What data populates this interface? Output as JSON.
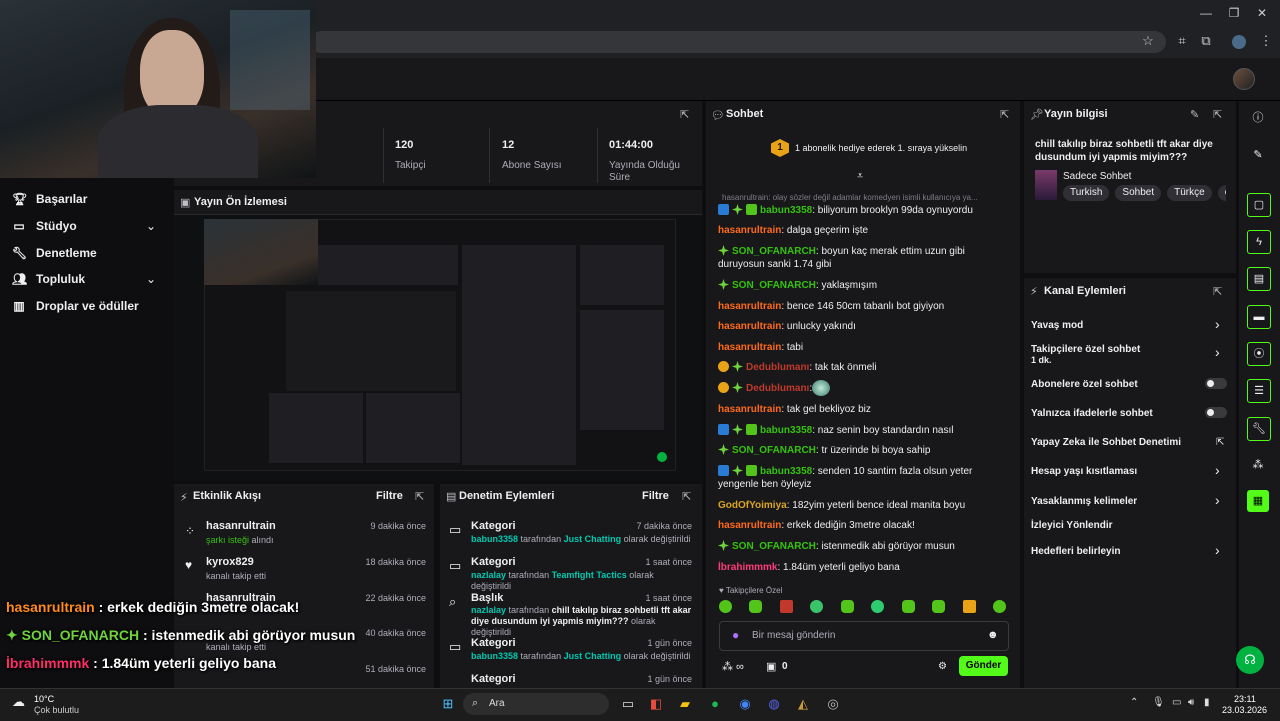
{
  "header": {
    "stats": [
      {
        "value": "120",
        "label": "Takipçi"
      },
      {
        "value": "12",
        "label": "Abone Sayısı"
      },
      {
        "value": "01:44:00",
        "label": "Yayında Olduğu Süre"
      }
    ]
  },
  "nav": {
    "items": [
      {
        "label": "Başarılar"
      },
      {
        "label": "Stüdyo"
      },
      {
        "label": "Denetleme"
      },
      {
        "label": "Topluluk"
      },
      {
        "label": "Droplar ve ödüller"
      }
    ]
  },
  "preview": {
    "title": "Yayın Ön İzlemesi"
  },
  "activity": {
    "title": "Etkinlik Akışı",
    "filter": "Filtre",
    "items": [
      {
        "name": "hasanrultrain",
        "sub_a": "şarkı isteği",
        "sub_b": " alındı",
        "time": "9 dakika önce"
      },
      {
        "name": "kyrox829",
        "sub": "kanalı takip etti",
        "time": "18 dakika önce"
      },
      {
        "name": "hasanrultrain",
        "sub": "",
        "time": "22 dakika önce"
      },
      {
        "name": "",
        "sub": "kanalı takip etti",
        "time": "40 dakika önce"
      },
      {
        "name": "",
        "sub": "",
        "time": "51 dakika önce"
      }
    ]
  },
  "modlog": {
    "title": "Denetim Eylemleri",
    "filter": "Filtre",
    "by": "tarafından",
    "changed": "olarak değiştirildi",
    "items": [
      {
        "type": "Kategori",
        "user": "babun3358",
        "value": "Just Chatting",
        "time": "7 dakika önce"
      },
      {
        "type": "Kategori",
        "user": "nazlalay",
        "value": "Teamfight Tactics",
        "time": "1 saat önce"
      },
      {
        "type": "Başlık",
        "user": "nazlalay",
        "value": "chill takılıp biraz sohbetli tft akar diye dusundum iyi yapmis miyim???",
        "time": "1 saat önce"
      },
      {
        "type": "Kategori",
        "user": "babun3358",
        "value": "Just Chatting",
        "time": "1 gün önce"
      },
      {
        "type": "Kategori",
        "user": "",
        "value": "",
        "time": "1 gün önce"
      }
    ]
  },
  "overlay": {
    "lines": [
      {
        "user": "hasanrultrain",
        "msg": " : erkek dediğin 3metre olacak!"
      },
      {
        "user": "SON_OFANARCH",
        "msg": " : istenmedik abi görüyor musun"
      },
      {
        "user": "İbrahimmmk",
        "msg": " : 1.84üm yeterli geliyo bana"
      }
    ]
  },
  "chat": {
    "title": "Sohbet",
    "gift_banner": "1 abonelik hediye ederek 1. sıraya yükselin",
    "gift_rank": "1",
    "pinned_preview": "hasanrultrain: olay sözler değil adamlar komedyen isimli kullanıcıya ya...",
    "messages": [
      {
        "user": "babun3358",
        "cls": "u-green",
        "badges": [
          "b-blue",
          "b-green",
          "b-sub"
        ],
        "text": ": biliyorum brooklyn 99da oynuyordu"
      },
      {
        "user": "hasanrultrain",
        "cls": "u-orange",
        "badges": [],
        "text": ": dalga geçerim işte"
      },
      {
        "user": "SON_OFANARCH",
        "cls": "u-green",
        "badges": [
          "b-green"
        ],
        "text": ": boyun kaç merak ettim uzun gibi duruyosun sanki 1.74 gibi"
      },
      {
        "user": "SON_OFANARCH",
        "cls": "u-green",
        "badges": [
          "b-green"
        ],
        "text": ": yaklaşmışım"
      },
      {
        "user": "hasanrultrain",
        "cls": "u-orange",
        "badges": [],
        "text": ": bence 146 50cm tabanlı bot giyiyon"
      },
      {
        "user": "hasanrultrain",
        "cls": "u-orange",
        "badges": [],
        "text": ": unlucky yakındı"
      },
      {
        "user": "hasanrultrain",
        "cls": "u-orange",
        "badges": [],
        "text": ": tabi"
      },
      {
        "user": "Dedublumanı",
        "cls": "u-red",
        "badges": [
          "b-gold",
          "b-green"
        ],
        "text": ": tak tak önmeli"
      },
      {
        "user": "Dedublumanı",
        "cls": "u-red",
        "badges": [
          "b-gold",
          "b-green"
        ],
        "text": ":"
      },
      {
        "user": "hasanrultrain",
        "cls": "u-orange",
        "badges": [],
        "text": ": tak gel bekliyoz biz"
      },
      {
        "user": "babun3358",
        "cls": "u-green",
        "badges": [
          "b-blue",
          "b-green",
          "b-sub"
        ],
        "text": ": naz senin boy standardın nasıl"
      },
      {
        "user": "SON_OFANARCH",
        "cls": "u-green",
        "badges": [
          "b-green"
        ],
        "text": ": tr üzerinde bi boya sahip"
      },
      {
        "user": "babun3358",
        "cls": "u-green",
        "badges": [
          "b-blue",
          "b-green",
          "b-sub"
        ],
        "text": ": senden 10 santim fazla olsun yeter yengenle ben öyleyiz"
      },
      {
        "user": "GodOfYoimiya",
        "cls": "u-gold",
        "badges": [],
        "text": ": 182yim yeterli bence ideal manita boyu"
      },
      {
        "user": "hasanrultrain",
        "cls": "u-orange",
        "badges": [],
        "text": ": erkek dediğin 3metre olacak!"
      },
      {
        "user": "SON_OFANARCH",
        "cls": "u-green",
        "badges": [
          "b-green"
        ],
        "text": ": istenmedik abi görüyor musun"
      },
      {
        "user": "İbrahimmmk",
        "cls": "u-pink",
        "badges": [],
        "text": ": 1.84üm yeterli geliyo bana"
      }
    ],
    "followers_only": "Takipçilere Özel",
    "input_placeholder": "Bir mesaj gönderin",
    "points": "0",
    "send_label": "Gönder"
  },
  "stream_info": {
    "title": "Yayın bilgisi",
    "stream_title": "chill takılıp biraz sohbetli tft akar diye dusundum iyi yapmis miyim???",
    "category": "Sadece Sohbet",
    "tags": [
      "Turkish",
      "Sohbet",
      "Türkçe",
      "chi"
    ]
  },
  "channel_actions": {
    "title": "Kanal Eylemleri",
    "items": [
      {
        "label": "Yavaş mod",
        "kind": "chevron"
      },
      {
        "label": "Takipçilere özel sohbet",
        "sub": "1 dk.",
        "kind": "chevron"
      },
      {
        "label": "Abonelere özel sohbet",
        "kind": "toggle"
      },
      {
        "label": "Yalnızca ifadelerle sohbet",
        "kind": "toggle"
      },
      {
        "label": "Yapay Zeka ile Sohbet Denetimi",
        "kind": "external"
      },
      {
        "label": "Hesap yaşı kısıtlaması",
        "kind": "chevron"
      },
      {
        "label": "Yasaklanmış kelimeler",
        "kind": "chevron"
      },
      {
        "label": "İzleyici Yönlendir",
        "kind": "none"
      },
      {
        "label": "Hedefleri belirleyin",
        "kind": "chevron"
      }
    ]
  },
  "taskbar": {
    "weather_temp": "10°C",
    "weather_desc": "Çok bulutlu",
    "search_placeholder": "Ara",
    "time": "23:11",
    "date": "23.03.2026"
  }
}
